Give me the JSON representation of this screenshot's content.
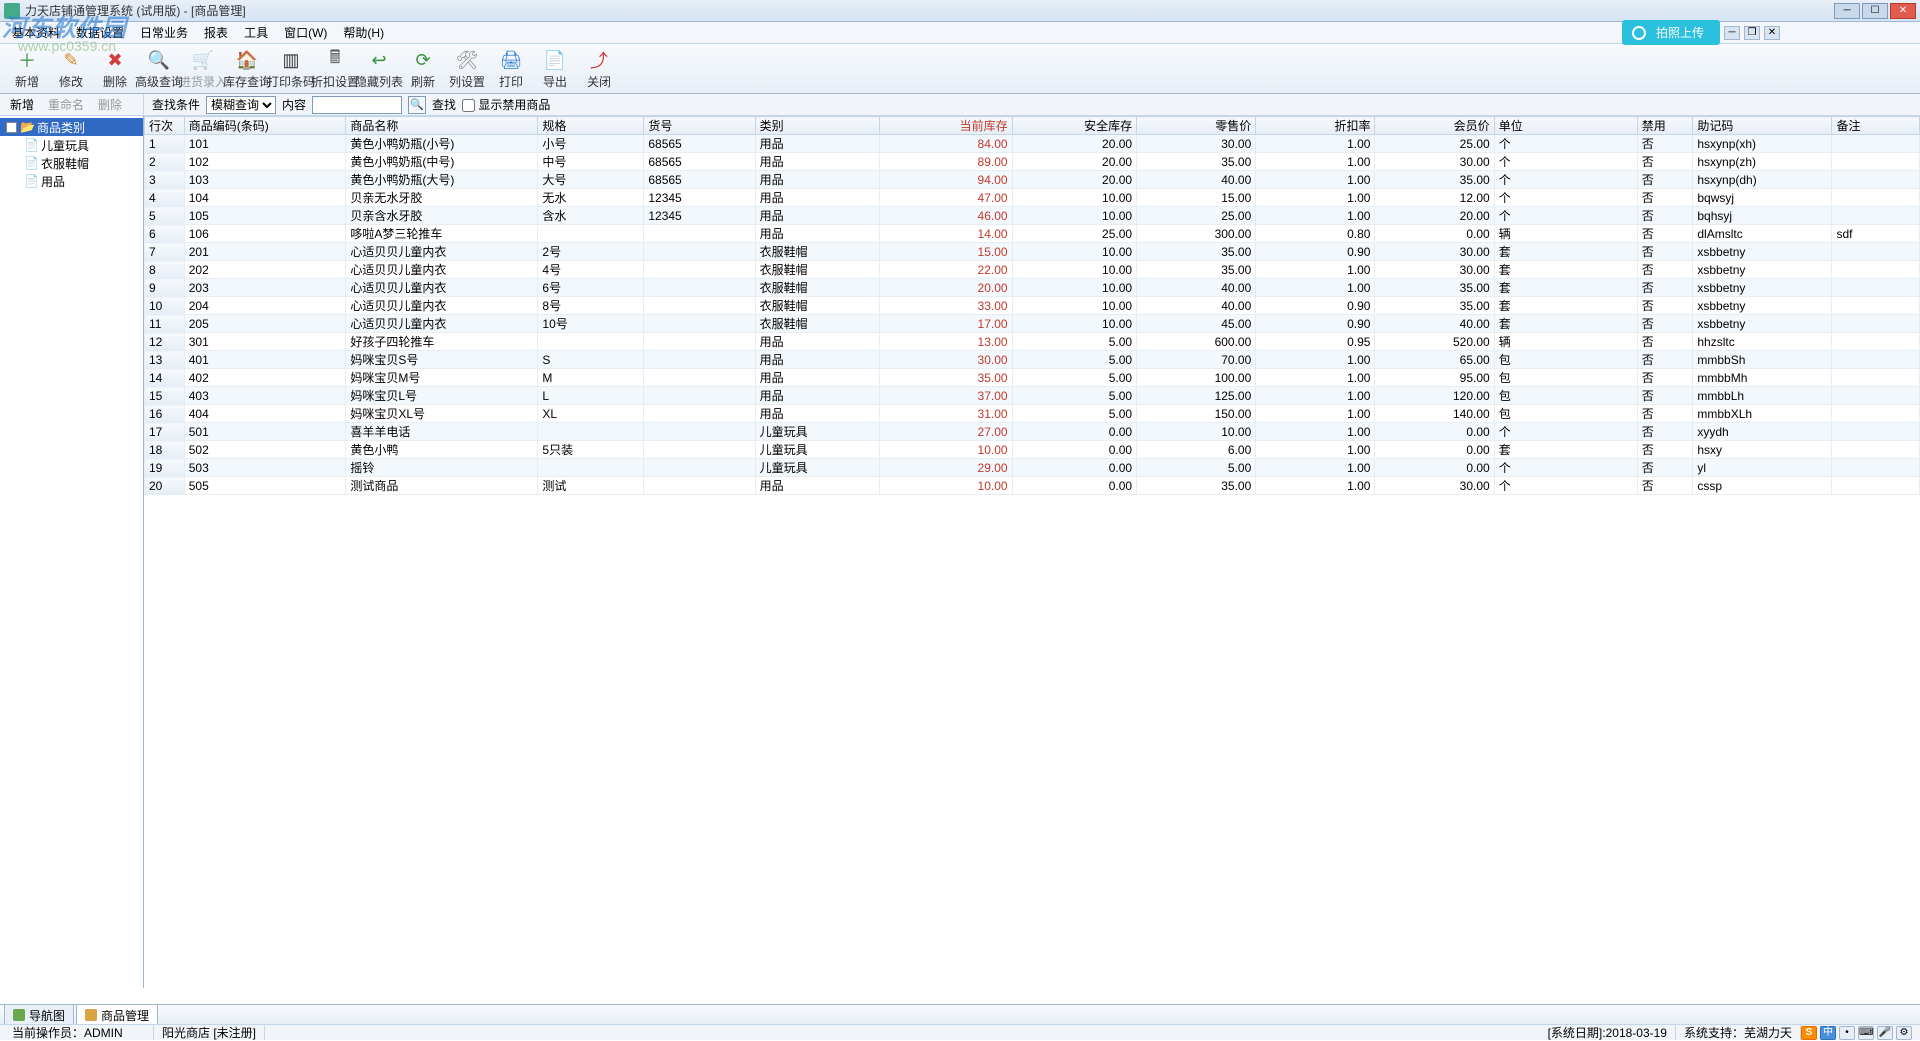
{
  "window": {
    "title": "力天店铺通管理系统 (试用版) - [商品管理]"
  },
  "watermark": {
    "line1": "河东软件园",
    "line2": "www.pc0359.cn"
  },
  "menu": {
    "items": [
      "基本资料",
      "数据设置",
      "日常业务",
      "报表",
      "工具",
      "窗口(W)",
      "帮助(H)"
    ],
    "upload": "拍照上传"
  },
  "toolbar": [
    {
      "id": "new",
      "label": "新增",
      "icon": "＋",
      "color": "#3a8f3a"
    },
    {
      "id": "edit",
      "label": "修改",
      "icon": "✎",
      "color": "#d48a2a"
    },
    {
      "id": "delete",
      "label": "删除",
      "icon": "✖",
      "color": "#d23b3b"
    },
    {
      "id": "advsearch",
      "label": "高级查询",
      "icon": "🔍",
      "color": "#2a7ad4"
    },
    {
      "id": "stockin",
      "label": "进货录入",
      "icon": "🛒",
      "color": "#999",
      "disabled": true
    },
    {
      "id": "stockquery",
      "label": "库存查询",
      "icon": "🏠",
      "color": "#d48a2a"
    },
    {
      "id": "printbarcode",
      "label": "打印条码",
      "icon": "▥",
      "color": "#333"
    },
    {
      "id": "discount",
      "label": "折扣设置",
      "icon": "🖩",
      "color": "#555"
    },
    {
      "id": "hidecol",
      "label": "隐藏列表",
      "icon": "↩",
      "color": "#3a8f3a"
    },
    {
      "id": "refresh",
      "label": "刷新",
      "icon": "⟳",
      "color": "#3a8f3a"
    },
    {
      "id": "colset",
      "label": "列设置",
      "icon": "🛠",
      "color": "#888"
    },
    {
      "id": "print",
      "label": "打印",
      "icon": "🖨",
      "color": "#2a7ad4"
    },
    {
      "id": "export",
      "label": "导出",
      "icon": "📄",
      "color": "#d48a2a"
    },
    {
      "id": "close",
      "label": "关闭",
      "icon": "⤴",
      "color": "#d23b3b"
    }
  ],
  "secbar": {
    "left": {
      "new": "新增",
      "rename": "重命名",
      "delete": "删除"
    },
    "cond_label": "查找条件",
    "cond_select": "模糊查询",
    "content_label": "内容",
    "content_value": "",
    "search": "查找",
    "show_disabled": "显示禁用商品"
  },
  "tree": {
    "root": "商品类别",
    "children": [
      "儿童玩具",
      "衣服鞋帽",
      "用品"
    ]
  },
  "grid": {
    "headers": [
      "行次",
      "商品编码(条码)",
      "商品名称",
      "规格",
      "货号",
      "类别",
      "当前库存",
      "安全库存",
      "零售价",
      "折扣率",
      "会员价",
      "单位",
      "禁用",
      "助记码",
      "备注"
    ],
    "rows": [
      [
        "1",
        "101",
        "黄色小鸭奶瓶(小号)",
        "小号",
        "68565",
        "用品",
        "84.00",
        "20.00",
        "30.00",
        "1.00",
        "25.00",
        "个",
        "否",
        "hsxynp(xh)",
        ""
      ],
      [
        "2",
        "102",
        "黄色小鸭奶瓶(中号)",
        "中号",
        "68565",
        "用品",
        "89.00",
        "20.00",
        "35.00",
        "1.00",
        "30.00",
        "个",
        "否",
        "hsxynp(zh)",
        ""
      ],
      [
        "3",
        "103",
        "黄色小鸭奶瓶(大号)",
        "大号",
        "68565",
        "用品",
        "94.00",
        "20.00",
        "40.00",
        "1.00",
        "35.00",
        "个",
        "否",
        "hsxynp(dh)",
        ""
      ],
      [
        "4",
        "104",
        "贝亲无水牙胶",
        "无水",
        "12345",
        "用品",
        "47.00",
        "10.00",
        "15.00",
        "1.00",
        "12.00",
        "个",
        "否",
        "bqwsyj",
        ""
      ],
      [
        "5",
        "105",
        "贝亲含水牙胶",
        "含水",
        "12345",
        "用品",
        "46.00",
        "10.00",
        "25.00",
        "1.00",
        "20.00",
        "个",
        "否",
        "bqhsyj",
        ""
      ],
      [
        "6",
        "106",
        "哆啦A梦三轮推车",
        "",
        "",
        "用品",
        "14.00",
        "25.00",
        "300.00",
        "0.80",
        "0.00",
        "辆",
        "否",
        "dlAmsltc",
        "sdf"
      ],
      [
        "7",
        "201",
        "心适贝贝儿童内衣",
        "2号",
        "",
        "衣服鞋帽",
        "15.00",
        "10.00",
        "35.00",
        "0.90",
        "30.00",
        "套",
        "否",
        "xsbbetny",
        ""
      ],
      [
        "8",
        "202",
        "心适贝贝儿童内衣",
        "4号",
        "",
        "衣服鞋帽",
        "22.00",
        "10.00",
        "35.00",
        "1.00",
        "30.00",
        "套",
        "否",
        "xsbbetny",
        ""
      ],
      [
        "9",
        "203",
        "心适贝贝儿童内衣",
        "6号",
        "",
        "衣服鞋帽",
        "20.00",
        "10.00",
        "40.00",
        "1.00",
        "35.00",
        "套",
        "否",
        "xsbbetny",
        ""
      ],
      [
        "10",
        "204",
        "心适贝贝儿童内衣",
        "8号",
        "",
        "衣服鞋帽",
        "33.00",
        "10.00",
        "40.00",
        "0.90",
        "35.00",
        "套",
        "否",
        "xsbbetny",
        ""
      ],
      [
        "11",
        "205",
        "心适贝贝儿童内衣",
        "10号",
        "",
        "衣服鞋帽",
        "17.00",
        "10.00",
        "45.00",
        "0.90",
        "40.00",
        "套",
        "否",
        "xsbbetny",
        ""
      ],
      [
        "12",
        "301",
        "好孩子四轮推车",
        "",
        "",
        "用品",
        "13.00",
        "5.00",
        "600.00",
        "0.95",
        "520.00",
        "辆",
        "否",
        "hhzsltc",
        ""
      ],
      [
        "13",
        "401",
        "妈咪宝贝S号",
        "S",
        "",
        "用品",
        "30.00",
        "5.00",
        "70.00",
        "1.00",
        "65.00",
        "包",
        "否",
        "mmbbSh",
        ""
      ],
      [
        "14",
        "402",
        "妈咪宝贝M号",
        "M",
        "",
        "用品",
        "35.00",
        "5.00",
        "100.00",
        "1.00",
        "95.00",
        "包",
        "否",
        "mmbbMh",
        ""
      ],
      [
        "15",
        "403",
        "妈咪宝贝L号",
        "L",
        "",
        "用品",
        "37.00",
        "5.00",
        "125.00",
        "1.00",
        "120.00",
        "包",
        "否",
        "mmbbLh",
        ""
      ],
      [
        "16",
        "404",
        "妈咪宝贝XL号",
        "XL",
        "",
        "用品",
        "31.00",
        "5.00",
        "150.00",
        "1.00",
        "140.00",
        "包",
        "否",
        "mmbbXLh",
        ""
      ],
      [
        "17",
        "501",
        "喜羊羊电话",
        "",
        "",
        "儿童玩具",
        "27.00",
        "0.00",
        "10.00",
        "1.00",
        "0.00",
        "个",
        "否",
        "xyydh",
        ""
      ],
      [
        "18",
        "502",
        "黄色小鸭",
        "5只装",
        "",
        "儿童玩具",
        "10.00",
        "0.00",
        "6.00",
        "1.00",
        "0.00",
        "套",
        "否",
        "hsxy",
        ""
      ],
      [
        "19",
        "503",
        "摇铃",
        "",
        "",
        "儿童玩具",
        "29.00",
        "0.00",
        "5.00",
        "1.00",
        "0.00",
        "个",
        "否",
        "yl",
        ""
      ],
      [
        "20",
        "505",
        "测试商品",
        "测试",
        "",
        "用品",
        "10.00",
        "0.00",
        "35.00",
        "1.00",
        "30.00",
        "个",
        "否",
        "cssp",
        ""
      ]
    ]
  },
  "tabs": {
    "nav": "导航图",
    "prod": "商品管理"
  },
  "status": {
    "operator": "当前操作员：ADMIN",
    "store": "阳光商店 [未注册]",
    "sysdate": "[系统日期]:2018-03-19",
    "support": "系统支持：芜湖力天"
  },
  "ime": [
    "S",
    "中",
    "ㄅ",
    "",
    "",
    ""
  ]
}
